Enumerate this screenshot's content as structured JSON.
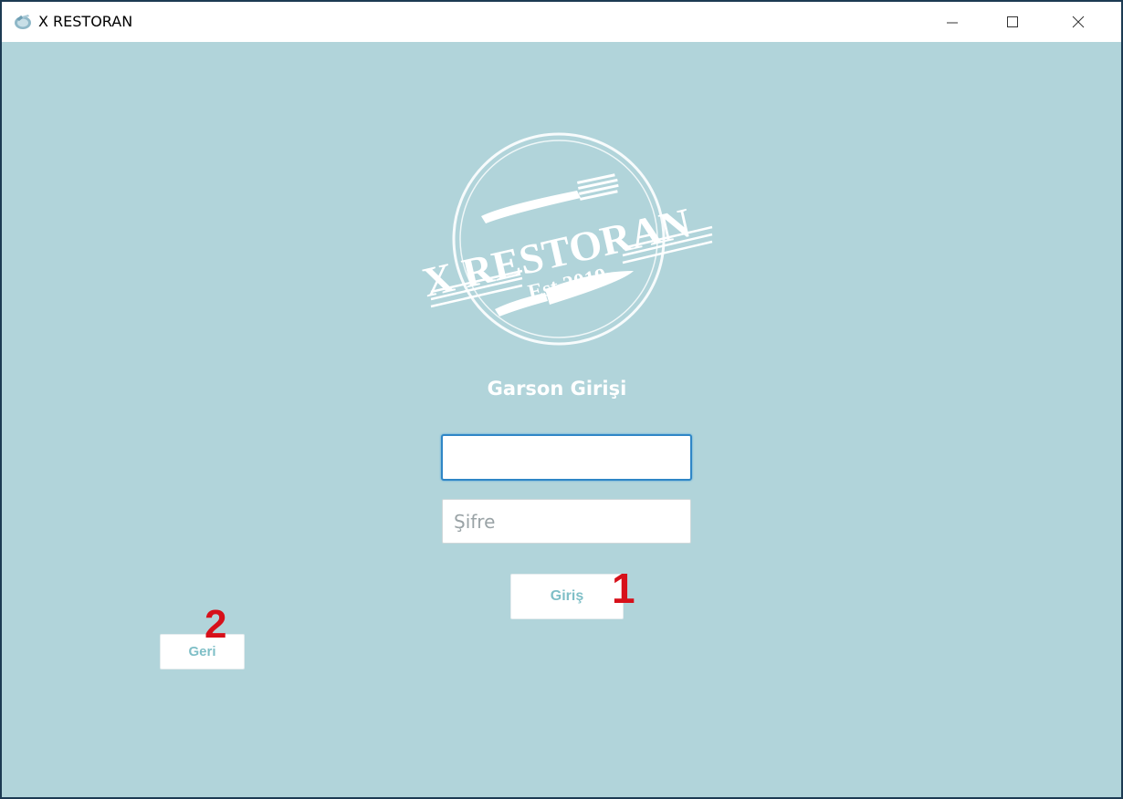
{
  "window": {
    "title": "X RESTORAN",
    "controls": {
      "minimize": "minimize-icon",
      "maximize": "maximize-icon",
      "close": "close-icon"
    }
  },
  "logo": {
    "name": "X RESTORAN",
    "established": "Est 2019"
  },
  "login": {
    "heading": "Garson Girişi",
    "username": {
      "value": "",
      "placeholder": ""
    },
    "password": {
      "value": "",
      "placeholder": "Şifre"
    },
    "submit_label": "Giriş",
    "back_label": "Geri"
  },
  "annotations": {
    "marker_1": "1",
    "marker_2": "2"
  },
  "colors": {
    "background": "#b1d4da",
    "button_text": "#7fbfc7",
    "focus_border": "#2f86c6",
    "annotation": "#d7101a"
  }
}
